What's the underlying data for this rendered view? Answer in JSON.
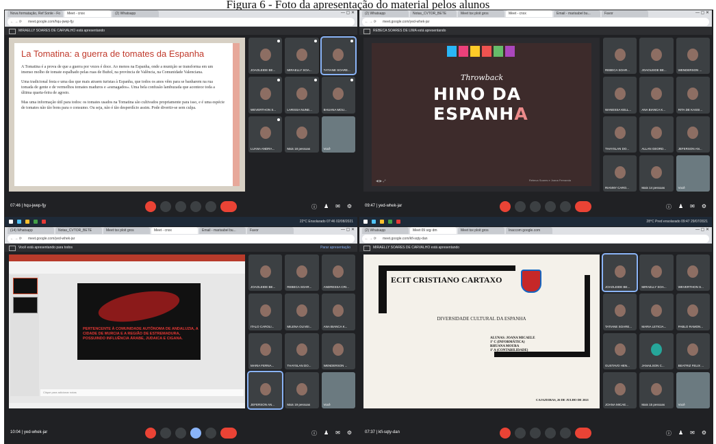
{
  "caption": "Figura 6 - Foto da apresentação do material pelos alunos",
  "q1": {
    "tabs": [
      "Nova formatação, Ref Sonle - Fo",
      "Meet - cnxx",
      "(2) Whatsapp"
    ],
    "url": "meet.google.com/hqu-jwep-fjy",
    "presenter": "MIRAELLY SOARES DE CARVALHO está apresentando",
    "slide_title": "La Tomatina: a guerra de tomates da Espanha",
    "slide_p1": "A Tomatina é a prova de que a guerra por vezes é doce. Ao menos na Espanha, onde a munição se transforma em um imenso molho de tomate espalhado pelas ruas de Buñol, na província de Valência, na Comunidade Valenciana.",
    "slide_p2": "Uma tradicional festa e uma das que mais atraem turistas à Espanha, que todos os anos vêm para se banharem na rua tomada de gente e de vermelhos tomates maduros e «esmagados». Uma bela confusão lambuzada que acontece toda a última quarta-feira de agosto.",
    "slide_p3": "Mas uma informação útil para todos: os tomates usados na Tomatina são cultivados propriamente para isso, e é uma espécie de tomates não tão bons para o consumo. Ou seja, não é tão desperdício assim. Pode divertir-se sem culpa.",
    "tiles": [
      "JOAOLEIDE BE...",
      "MIRAELLY SOA...",
      "TATIANE SOARE...",
      "WEVERTHON S...",
      "LARISSA NUNE...",
      "BHUANA MOU...",
      "LUANA ANDRA...",
      "Mais 18 pessoas",
      "Você"
    ],
    "clock": "07:46 | hqu-jwep-fjy",
    "taskbar": "22°C Ensolarado  07:46 02/08/2021"
  },
  "q2": {
    "tabs": [
      "(2) Whatsapp",
      "Notas_CVTOR_BETE",
      "Meet tsx ploit gros",
      "Meet - cnxx",
      "Email - marisabel bu...",
      "Favor"
    ],
    "url": "meet.google.com/yed-whek-jar",
    "presenter": "REBECA SOARES DE LIMA está apresentando",
    "throwback": "Throwback",
    "hino_a": "HINO DA ESPANH",
    "hino_b": "A",
    "credit": "Rebeca Soares e Joana Fernanda",
    "tiles": [
      "REBECA SOAR...",
      "JOAOLEIDE BE...",
      "WENDERSON ...",
      "WANESSA KELL...",
      "ANA BIANCA K...",
      "RITA DE KASSI...",
      "THAYSLAN DO...",
      "ALLAN GEORD...",
      "JEFERSON AN...",
      "RIANNY CARO...",
      "Mais 14 pessoas",
      "Você"
    ],
    "clock": "09:47 | yed-whek-jar",
    "taskbar": "28°C Pred ensolarado  09:47 29/07/2021"
  },
  "q3": {
    "tabs": [
      "(14) Whatsapp",
      "Notas_CVTOR_BETE",
      "Meet tsx ploit gros",
      "Meet - cnxx",
      "Email - marisabel bu...",
      "Favor"
    ],
    "url": "meet.google.com/yed-whek-jar",
    "presenter": "Você está apresentando para todos",
    "stop": "Parar apresentação",
    "slide_text": "PERTENCENTE À COMUNIDADE AUTÔNOMA DE ANDALUZIA, A CIDADE DE MURCIA E A REGIÃO DE ESTREMADURA, POSSUINDO INFLUÊNCIA ÁRABE, JUDAICA E CIGANA.",
    "notes": "Clique para adicionar notas",
    "tiles": [
      "JOAOLEIDE BE...",
      "REBECA SOAR...",
      "ANDRESSA CRI...",
      "ITALO CAROLI...",
      "MILENA OLIVEI...",
      "ANA BIANCA K...",
      "MARIA FERNA...",
      "THAYSLAN DO...",
      "WENDERSON ...",
      "JEFERSON AN...",
      "Mais 19 pessoas",
      "Você"
    ],
    "clock": "10:04 | yed-whek-jar"
  },
  "q4": {
    "tabs": [
      "(2) Whatsapp",
      "Meet 09 sqy dm",
      "Meet tsx ploit gros",
      "Inaccom google.com"
    ],
    "url": "meet.google.com/kfi-sqty-dan",
    "presenter": "MIRAELLY SOARES DE CARVALHO está apresentando",
    "school": "ECIT CRISTIANO CARTAXO",
    "subject": "DIVERSIDADE CULTURAL DA ESPANHA",
    "students": "ALUNAS: JOANA MICAELE\n1º C (INFORMÁTICA)\nRHUANA MOURA\n1º A (CONTABILIDADE)",
    "date": "CAJAZEIRAS, 26 DE JULHO DE 2021",
    "tiles": [
      "JOAOLEIDE BE...",
      "MIRAELLY SOA...",
      "WEVERTHON S...",
      "TATIANE SOARE...",
      "MARIA LETICIA...",
      "PABLO RAMON...",
      "GUSTAVO HEN...",
      "JANAILSON C...",
      "BEATRIZ FELIX ...",
      "JOANA MICAE...",
      "Mais 15 pessoas",
      "Você"
    ],
    "clock": "07:37 | kfi-sqty-dan"
  }
}
